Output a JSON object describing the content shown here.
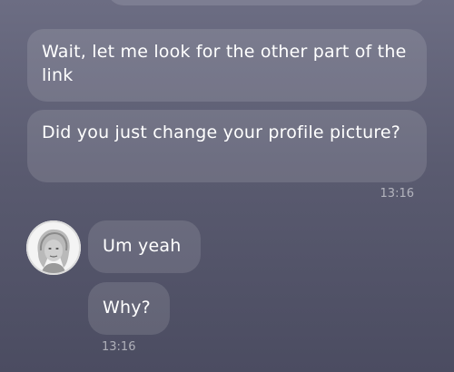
{
  "messages_outgoing": [
    {
      "text": "Wait, let me look for the other part of the link"
    },
    {
      "text": "Did you just change your profile picture?"
    }
  ],
  "outgoing_timestamp": "13:16",
  "messages_incoming": [
    {
      "text": "Um yeah"
    },
    {
      "text": "Why?"
    }
  ],
  "incoming_timestamp": "13:16",
  "contact": {
    "avatar_icon": "profile-photo"
  },
  "colors": {
    "background_top": "#6c6d83",
    "background_bottom": "#4b4c61",
    "bubble": "rgba(255,255,255,0.12)",
    "text": "#ffffff"
  }
}
